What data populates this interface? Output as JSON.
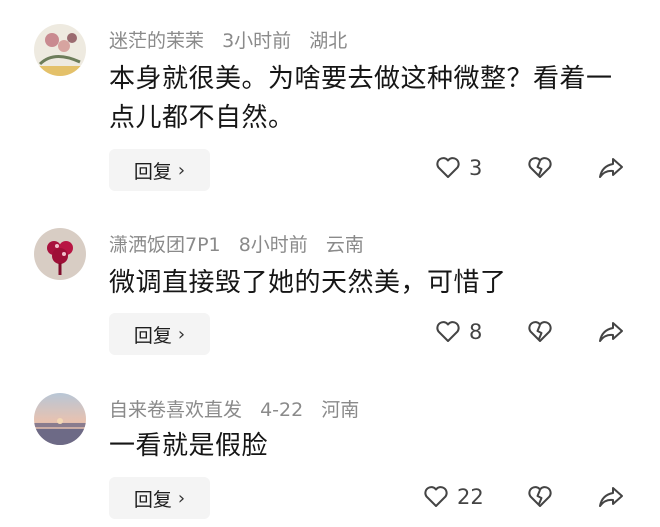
{
  "comments": [
    {
      "username": "迷茫的茉茉",
      "time": "3小时前",
      "location": "湖北",
      "text": "本身就很美。为啥要去做这种微整？看着一点儿都不自然。",
      "reply_label": "回复",
      "like_count": "3",
      "avatar_icon": "avatar-floral-icon"
    },
    {
      "username": "潇洒饭团7P1",
      "time": "8小时前",
      "location": "云南",
      "text": "微调直接毁了她的天然美，可惜了",
      "reply_label": "回复",
      "like_count": "8",
      "avatar_icon": "avatar-flower-icon"
    },
    {
      "username": "自来卷喜欢直发",
      "time": "4-22",
      "location": "河南",
      "text": "一看就是假脸",
      "reply_label": "回复",
      "like_count": "22",
      "avatar_icon": "avatar-sunset-icon"
    }
  ]
}
